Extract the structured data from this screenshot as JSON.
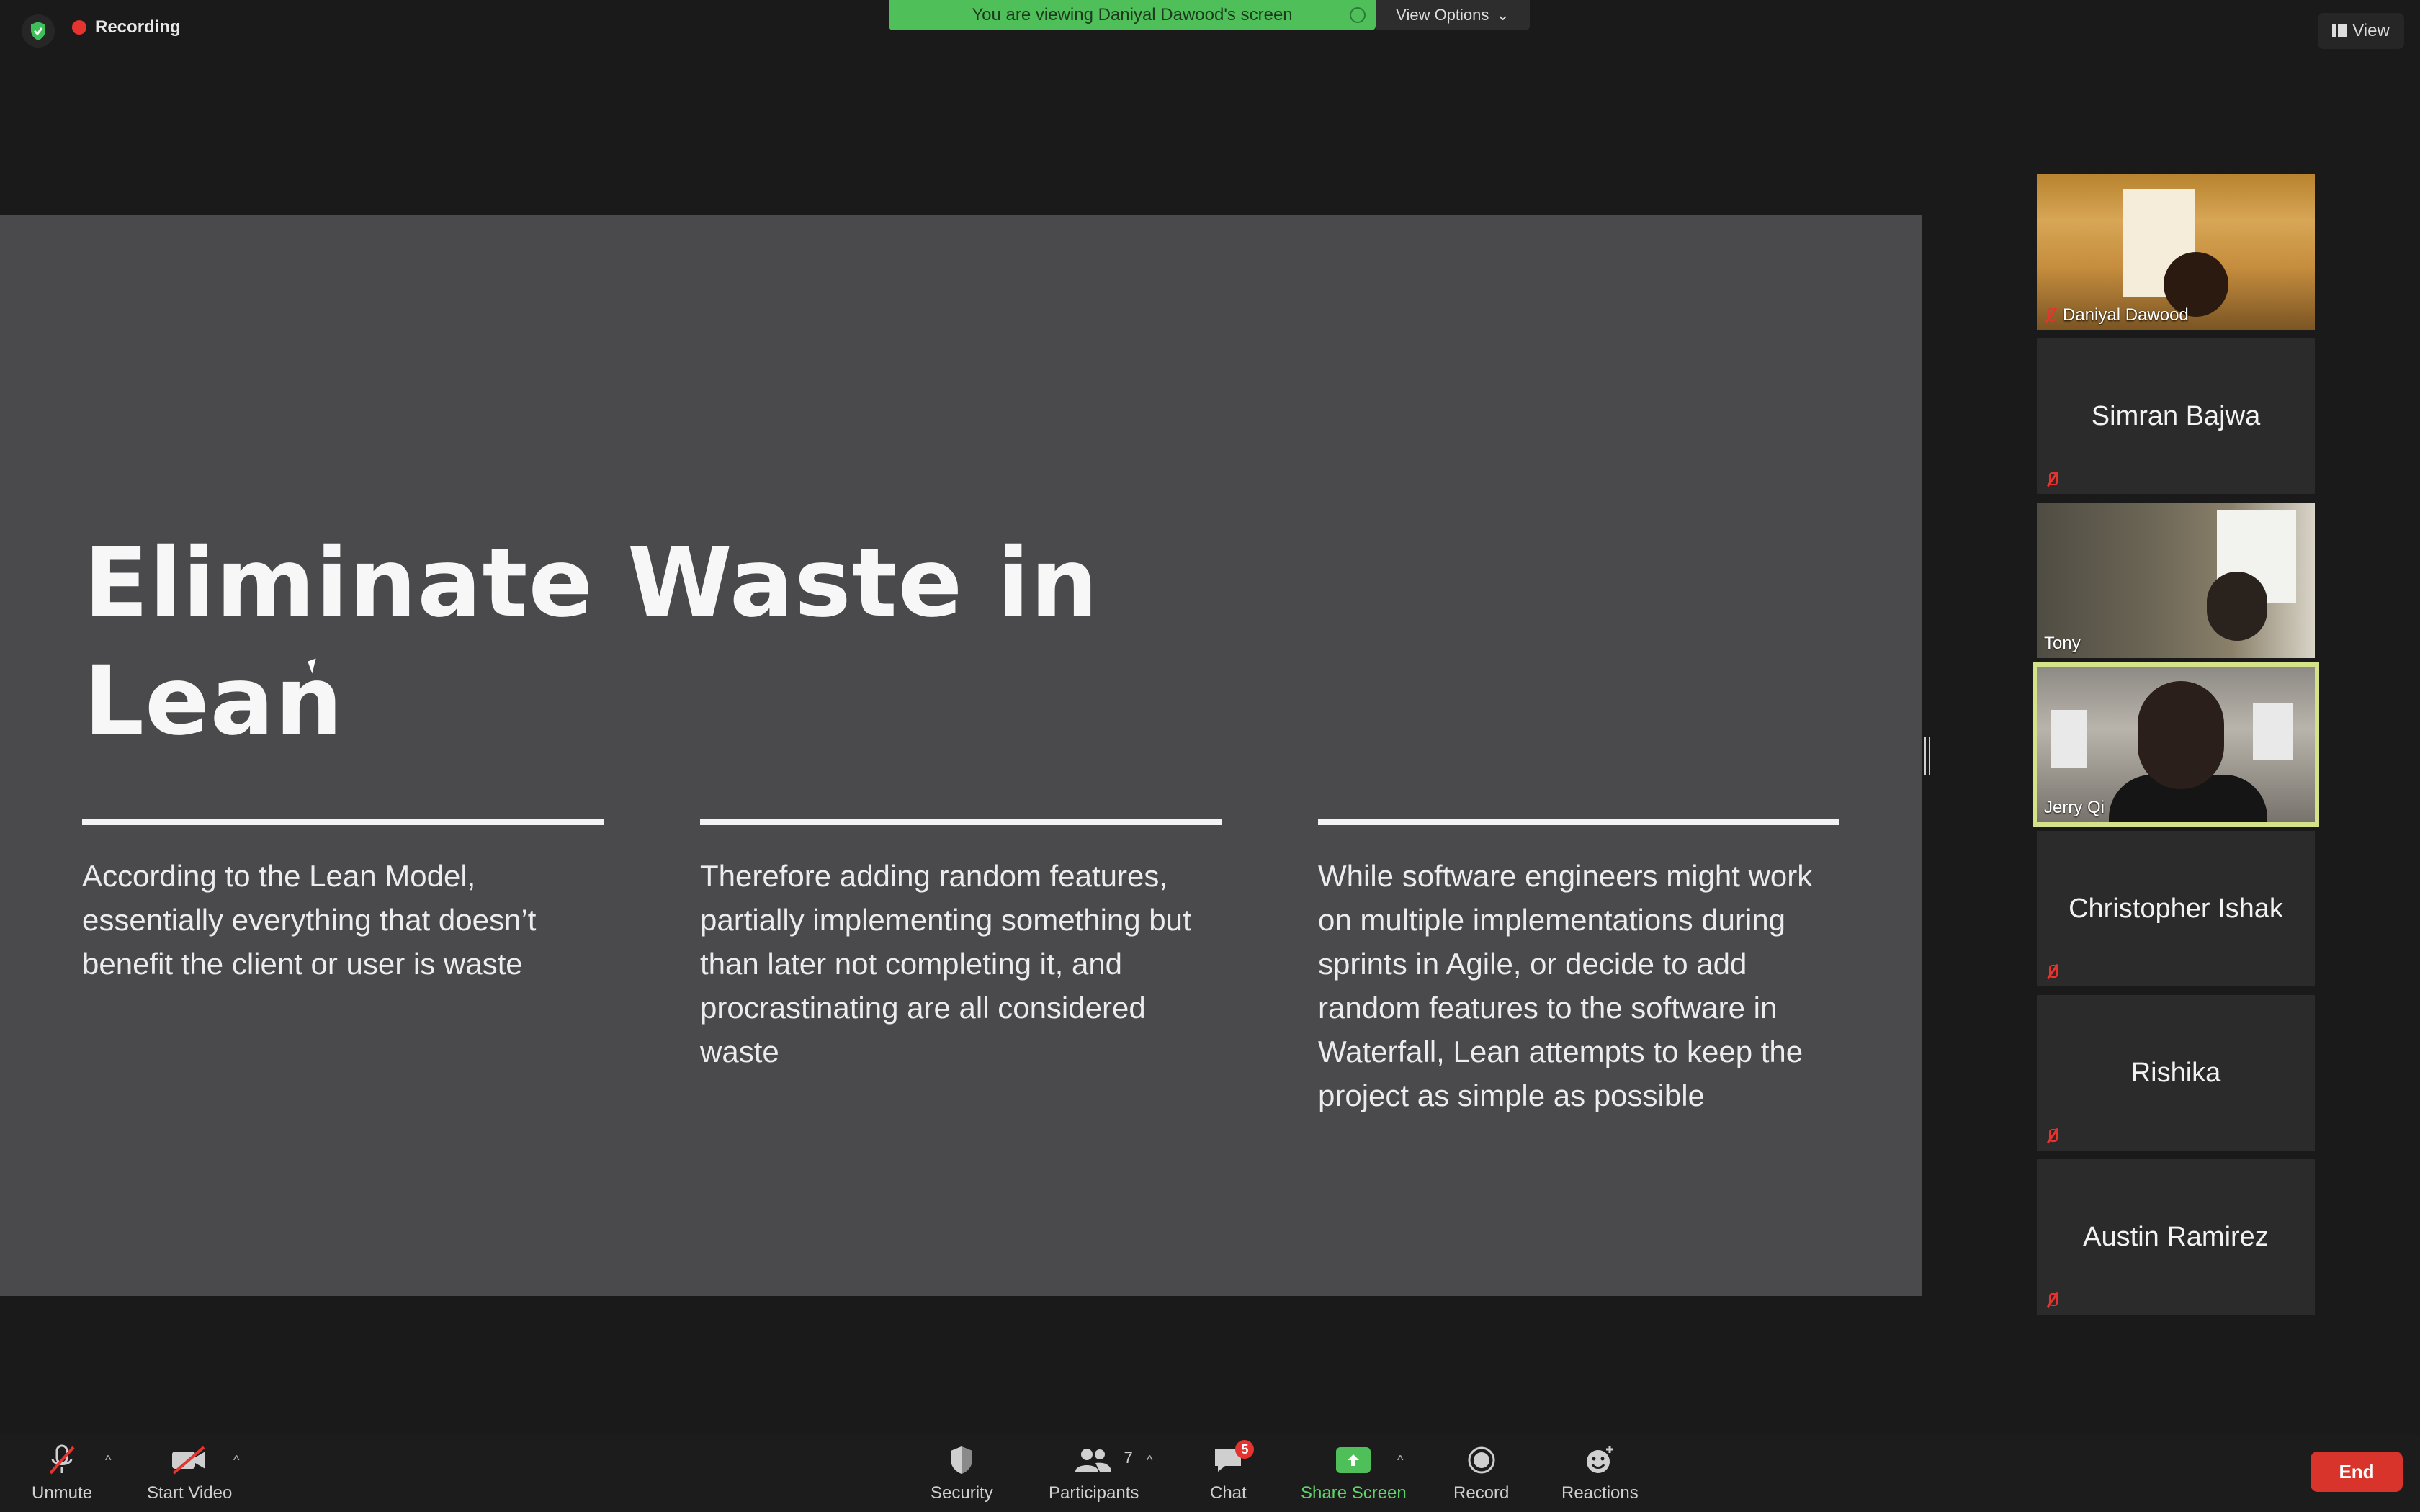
{
  "top": {
    "recording_label": "Recording",
    "banner_text": "You are viewing Daniyal Dawood's screen",
    "view_options_label": "View Options",
    "view_label": "View"
  },
  "slide": {
    "title_line1": "Eliminate Waste in",
    "title_line2": "Lean",
    "columns": [
      "According to the Lean Model, essentially everything that doesn’t benefit the client or user is waste",
      "Therefore adding random features, partially implementing something but than later not completing it, and procrastinating are all considered waste",
      "While software engineers might work on multiple implementations during sprints in Agile, or decide to add random features to the software in Waterfall, Lean attempts to keep the project as simple as possible"
    ]
  },
  "participants": [
    {
      "name": "Daniyal Dawood",
      "video": true,
      "muted": true
    },
    {
      "name": "Simran Bajwa",
      "video": false,
      "muted": true
    },
    {
      "name": "Tony",
      "video": true,
      "muted": false
    },
    {
      "name": "Jerry Qi",
      "video": true,
      "muted": false,
      "active": true
    },
    {
      "name": "Christopher Ishak",
      "video": false,
      "muted": true
    },
    {
      "name": "Rishika",
      "video": false,
      "muted": true
    },
    {
      "name": "Austin Ramirez",
      "video": false,
      "muted": true
    }
  ],
  "toolbar": {
    "unmute": "Unmute",
    "start_video": "Start Video",
    "security": "Security",
    "participants": "Participants",
    "participants_count": "7",
    "chat": "Chat",
    "chat_badge": "5",
    "share_screen": "Share Screen",
    "record": "Record",
    "reactions": "Reactions",
    "end": "End"
  },
  "colors": {
    "banner": "#4fbf5a",
    "end_button": "#d9342b",
    "active_speaker_border": "#d6e28a",
    "slide_bg": "#4a4a4c"
  }
}
